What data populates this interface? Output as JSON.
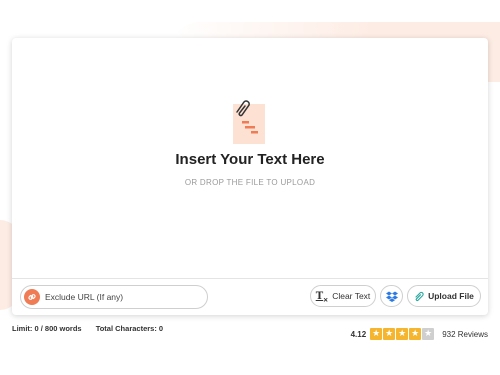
{
  "editor": {
    "title": "Insert Your Text Here",
    "subtitle": "OR DROP THE FILE TO UPLOAD"
  },
  "toolbar": {
    "url_placeholder": "Exclude URL (If any)",
    "clear_label": "Clear Text",
    "clear_icon_glyph": "T",
    "upload_label": "Upload File"
  },
  "footer": {
    "limit_label": "Limit: 0 / 800 words",
    "characters_label": "Total Characters: 0",
    "rating_value": "4.12",
    "rating_stars": 4,
    "rating_max": 5,
    "reviews_label": "932 Reviews"
  },
  "colors": {
    "accent": "#ef7c54",
    "star": "#f5b52e",
    "dropbox": "#2c7be5"
  },
  "icons": [
    "paperclip-document-icon",
    "link-icon",
    "clear-format-icon",
    "dropbox-icon",
    "paperclip-icon",
    "star-icon"
  ]
}
